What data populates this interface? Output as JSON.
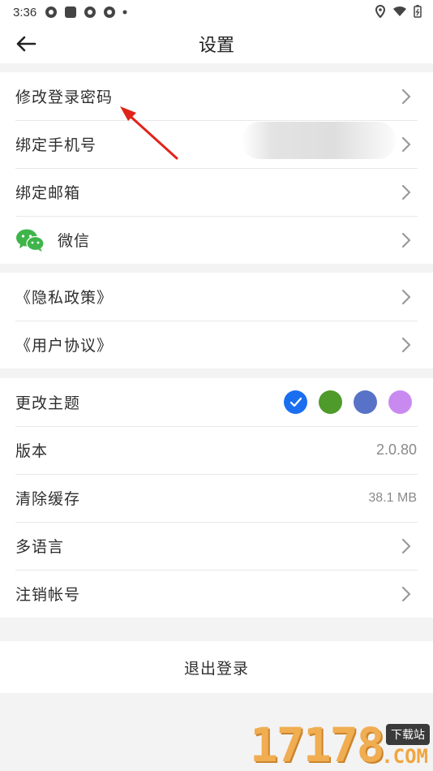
{
  "statusbar": {
    "time": "3:36"
  },
  "header": {
    "title": "设置"
  },
  "account": {
    "change_password": "修改登录密码",
    "bind_phone": "绑定手机号",
    "bind_email": "绑定邮箱",
    "wechat": "微信"
  },
  "legal": {
    "privacy": "《隐私政策》",
    "agreement": "《用户协议》"
  },
  "prefs": {
    "theme_label": "更改主题",
    "theme_colors": [
      "#1a6ef0",
      "#4e9a2a",
      "#5872c8",
      "#c98af0"
    ],
    "selected_theme": 0,
    "version_label": "版本",
    "version_value": "2.0.80",
    "cache_label": "清除缓存",
    "cache_value": "38.1 MB",
    "language_label": "多语言",
    "cancel_account_label": "注销帐号"
  },
  "logout": {
    "label": "退出登录"
  },
  "watermark": {
    "digits": "17178",
    "badge": "下载站",
    "suffix": ".COM"
  }
}
